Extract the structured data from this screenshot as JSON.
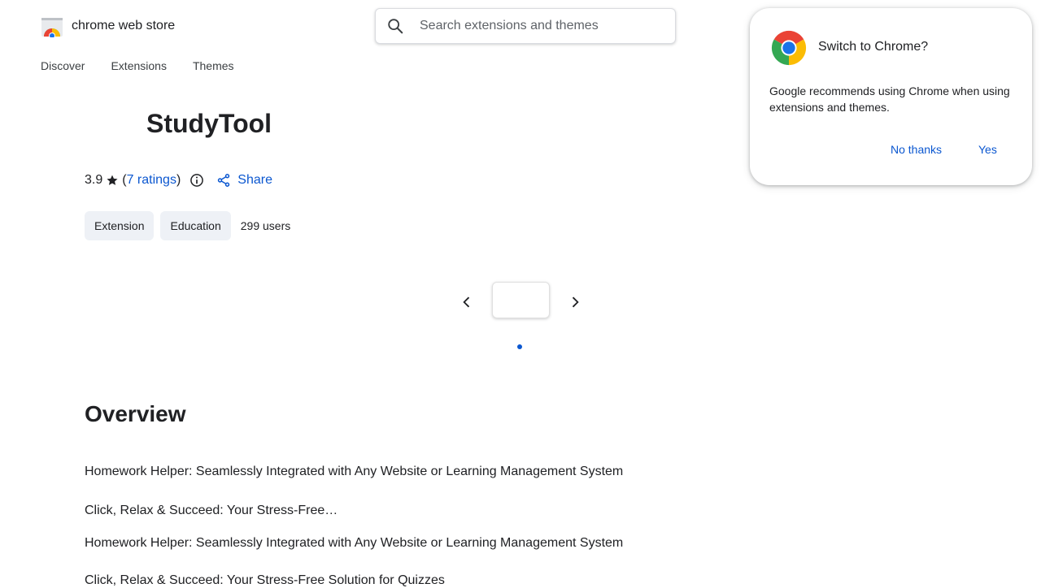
{
  "header": {
    "logo_text": "chrome web store",
    "search": {
      "placeholder": "Search extensions and themes",
      "value": ""
    }
  },
  "nav": {
    "items": [
      "Discover",
      "Extensions",
      "Themes"
    ]
  },
  "extension": {
    "title": "StudyTool",
    "rating": "3.9",
    "rating_open": "(",
    "ratings_count": "7 ratings",
    "rating_close": ")",
    "share_label": "Share",
    "chips": [
      "Extension",
      "Education"
    ],
    "users": "299 users"
  },
  "carousel": {
    "current_page": 1,
    "total_pages": 1
  },
  "overview": {
    "title": "Overview",
    "lines": [
      "Homework Helper: Seamlessly Integrated with Any Website or Learning Management System",
      "Click, Relax & Succeed: Your Stress-Free…",
      "Homework Helper: Seamlessly Integrated with Any Website or Learning Management System",
      "Click, Relax & Succeed: Your Stress-Free Solution for Quizzes"
    ]
  },
  "popup": {
    "title": "Switch to Chrome?",
    "body": "Google recommends using Chrome when using extensions and themes.",
    "no_label": "No thanks",
    "yes_label": "Yes"
  },
  "colors": {
    "accent": "#0b57d0",
    "chip_bg": "#eef1f6",
    "text": "#202124"
  },
  "icons": [
    "chrome-web-store-logo-icon",
    "search-icon",
    "star-icon",
    "info-icon",
    "share-icon",
    "chevron-left-icon",
    "chevron-right-icon",
    "chrome-icon"
  ]
}
